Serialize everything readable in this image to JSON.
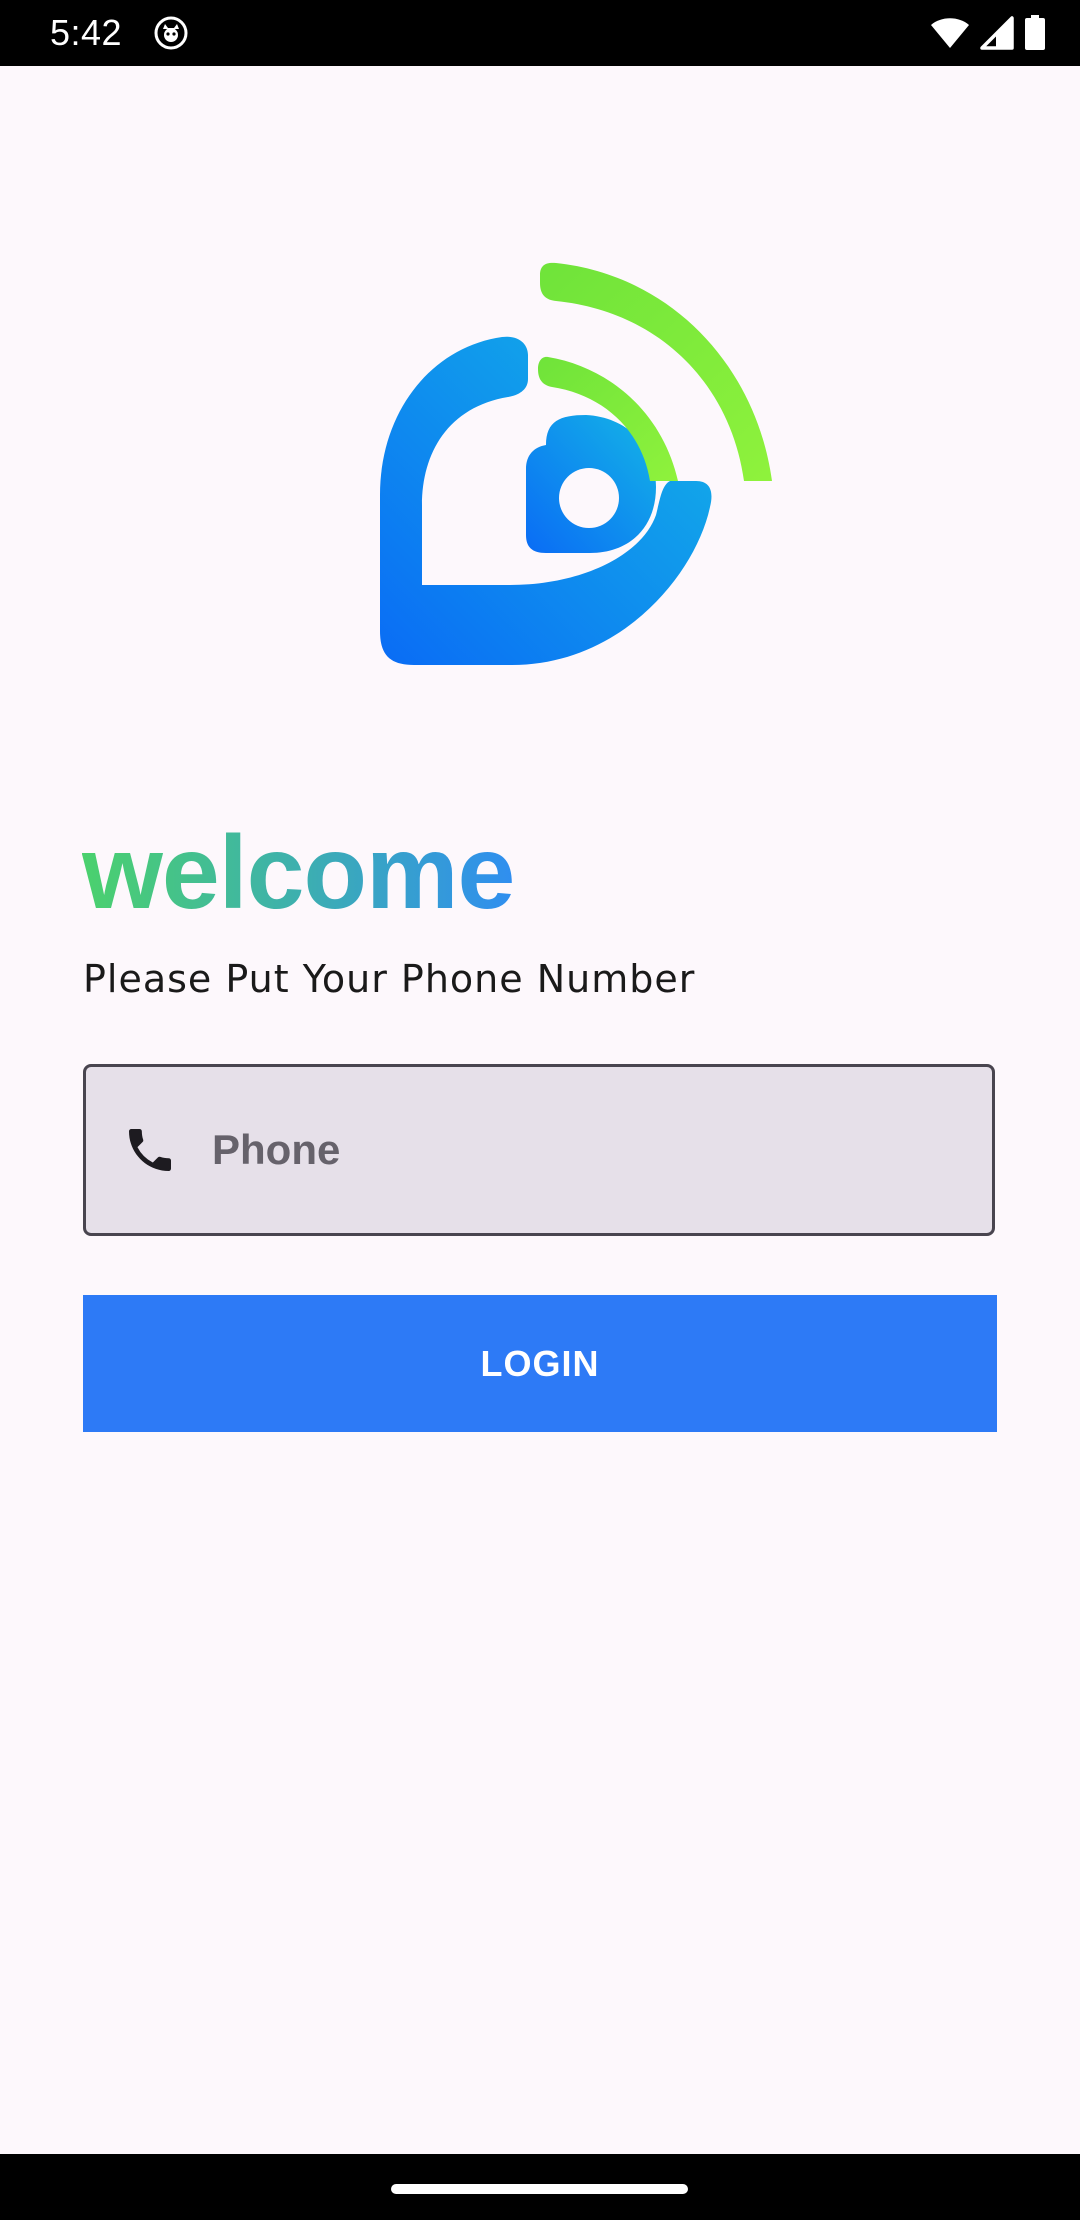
{
  "status_bar": {
    "time": "5:42",
    "icons": [
      "app-notification-icon",
      "wifi-icon",
      "cellular-signal-icon",
      "battery-icon"
    ]
  },
  "logo": {
    "icon": "signal-location-logo",
    "colors": {
      "blue_start": "#0a6cf5",
      "blue_end": "#14b5e6",
      "green_start": "#6fe33a",
      "green_end": "#8ff23c"
    }
  },
  "welcome": {
    "title": "welcome",
    "subtitle": "Please Put Your Phone Number",
    "gradient_start": "#4bd16d",
    "gradient_end": "#2f8ef0"
  },
  "phone_field": {
    "icon": "phone-icon",
    "placeholder": "Phone",
    "value": ""
  },
  "login_button": {
    "label": "LOGIN",
    "color": "#2d7af6"
  }
}
